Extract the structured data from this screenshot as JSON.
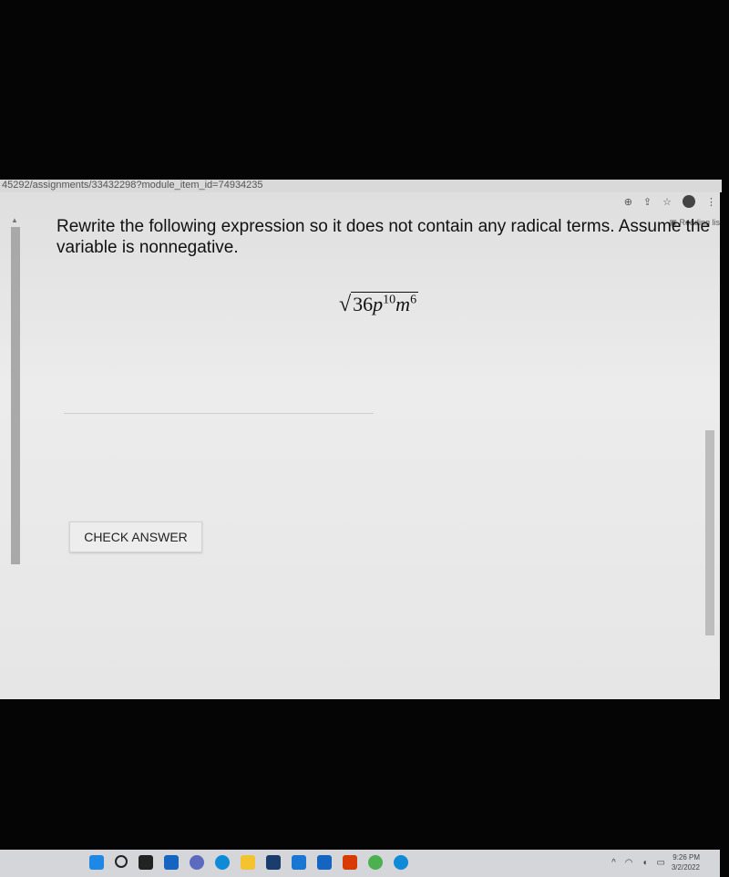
{
  "browser": {
    "url": "45292/assignments/33432298?module_item_id=74934235",
    "icons": [
      "zoom-icon",
      "share-icon",
      "star-icon",
      "profile-avatar",
      "menu-icon"
    ],
    "reading_list": "Reading lis"
  },
  "question": {
    "text": "Rewrite the following expression so it does not contain any radical terms. Assume the variable is nonnegative.",
    "expression": {
      "radical": "√",
      "coefficient": "36",
      "var1": "p",
      "exp1": "10",
      "var2": "m",
      "exp2": "6"
    }
  },
  "answer": {
    "value": ""
  },
  "check_answer_label": "CHECK ANSWER",
  "taskbar": {
    "apps": [
      {
        "name": "start",
        "color": "#1e88e5"
      },
      {
        "name": "search",
        "color": "#222222"
      },
      {
        "name": "task-view",
        "color": "#222222"
      },
      {
        "name": "widgets",
        "color": "#1565c0"
      },
      {
        "name": "teams-chat",
        "color": "#5c6bc0"
      },
      {
        "name": "edge",
        "color": "#0e8ad6"
      },
      {
        "name": "file-explorer",
        "color": "#f4c430"
      },
      {
        "name": "store",
        "color": "#1a3d6e"
      },
      {
        "name": "mail",
        "color": "#1976d2"
      },
      {
        "name": "app-s",
        "color": "#1565c0"
      },
      {
        "name": "office",
        "color": "#d83b01"
      },
      {
        "name": "chrome",
        "color": "#4caf50"
      },
      {
        "name": "edge-2",
        "color": "#0e8ad6"
      }
    ],
    "time": "9:26 PM",
    "date": "3/2/2022"
  }
}
